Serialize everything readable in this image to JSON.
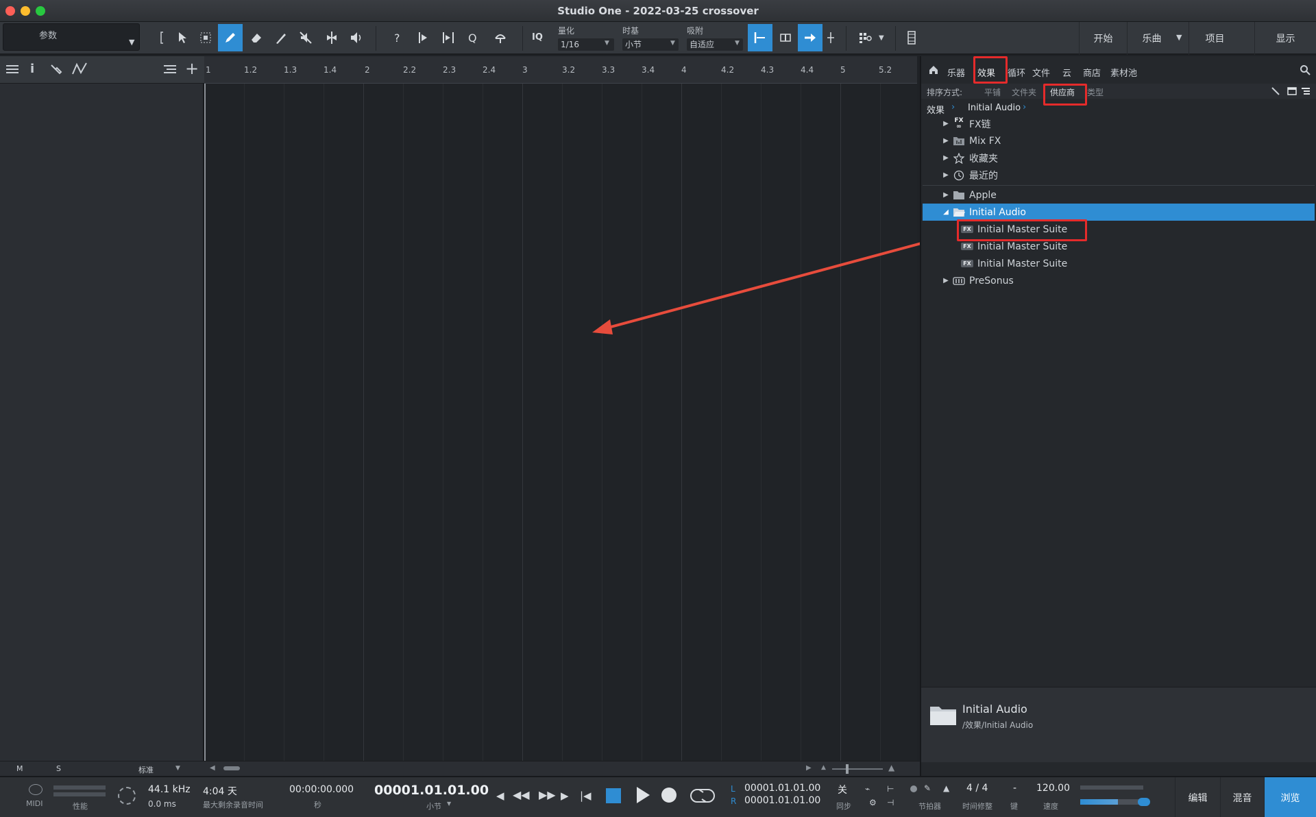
{
  "window": {
    "title": "Studio One - 2022-03-25 crossover"
  },
  "toolbar": {
    "param_label": "参数",
    "iq_label": "IQ",
    "quantize": {
      "label": "量化",
      "value": "1/16"
    },
    "timebase": {
      "label": "时基",
      "value": "小节"
    },
    "snap": {
      "label": "吸附",
      "value": "自适应"
    },
    "nav": {
      "start": "开始",
      "song": "乐曲",
      "project": "项目",
      "show": "显示"
    }
  },
  "ruler": {
    "labels": [
      "1",
      "1.2",
      "1.3",
      "1.4",
      "2",
      "2.2",
      "2.3",
      "2.4",
      "3",
      "3.2",
      "3.3",
      "3.4",
      "4",
      "4.2",
      "4.3",
      "4.4",
      "5",
      "5.2"
    ]
  },
  "browser": {
    "tabs": [
      "乐器",
      "效果",
      "循环",
      "文件",
      "云",
      "商店",
      "素材池"
    ],
    "active_tab": "效果",
    "sort": {
      "label": "排序方式:",
      "options": [
        "平铺",
        "文件夹",
        "供应商",
        "类型"
      ],
      "active": "供应商"
    },
    "breadcrumb": [
      "效果",
      "Initial Audio"
    ],
    "tree": [
      {
        "label": "FX链",
        "icon": "fx-chain-icon",
        "expanded": false,
        "level": 0
      },
      {
        "label": "Mix FX",
        "icon": "mixfx-icon",
        "expanded": false,
        "level": 0
      },
      {
        "label": "收藏夹",
        "icon": "star-icon",
        "expanded": false,
        "level": 0
      },
      {
        "label": "最近的",
        "icon": "clock-icon",
        "expanded": false,
        "level": 0
      },
      {
        "label": "Apple",
        "icon": "folder-icon",
        "expanded": false,
        "level": 0
      },
      {
        "label": "Initial Audio",
        "icon": "folder-open-icon",
        "expanded": true,
        "level": 0,
        "selected": true
      },
      {
        "label": "Initial Master Suite",
        "icon": "fx-plugin-icon",
        "level": 1,
        "badge": "FX"
      },
      {
        "label": "Initial Master Suite",
        "icon": "fx-plugin-icon",
        "level": 1,
        "badge": "FX"
      },
      {
        "label": "Initial Master Suite",
        "icon": "fx-plugin-icon",
        "level": 1,
        "badge": "FX"
      },
      {
        "label": "PreSonus",
        "icon": "presonus-icon",
        "expanded": false,
        "level": 0
      }
    ],
    "info": {
      "title": "Initial Audio",
      "path": "/效果/Initial Audio"
    }
  },
  "left_footer": {
    "m": "M",
    "s": "S",
    "mode": "标准"
  },
  "transport": {
    "midi": "MIDI",
    "performance": "性能",
    "sample_rate": "44.1 kHz",
    "latency": "0.0 ms",
    "record_time": "4:04 天",
    "record_time_label": "最大剩余录音时间",
    "seconds": "00:00:00.000",
    "seconds_label": "秒",
    "position": "00001.01.01.00",
    "position_label": "小节",
    "loop_l_label": "L",
    "loop_l": "00001.01.01.00",
    "loop_r_label": "R",
    "loop_r": "00001.01.01.00",
    "sync_state": "关",
    "sync_label": "同步",
    "metronome_label": "节拍器",
    "time_sig": "4 / 4",
    "time_sig_label": "时间修整",
    "key": "-",
    "key_label": "键",
    "tempo": "120.00",
    "tempo_label": "速度",
    "views": {
      "edit": "编辑",
      "mix": "混音",
      "browse": "浏览"
    }
  },
  "colors": {
    "accent": "#2f8dd3",
    "highlight": "#e52b2b",
    "background": "#202327"
  }
}
